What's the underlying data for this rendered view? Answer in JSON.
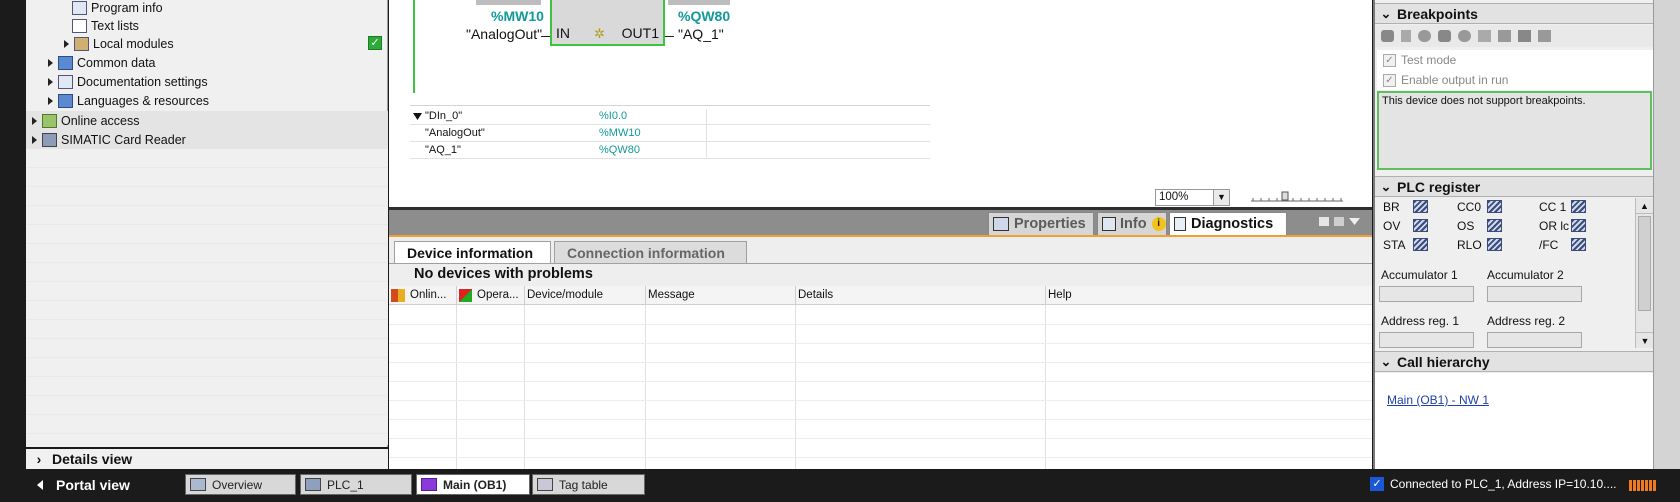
{
  "project_tree": {
    "items": [
      {
        "label": "Program info",
        "indent": 3,
        "icon": "program-info-icon"
      },
      {
        "label": "Text lists",
        "indent": 3,
        "icon": "text-lists-icon"
      },
      {
        "label": "Local modules",
        "indent": 2,
        "icon": "local-modules-icon"
      },
      {
        "label": "Common data",
        "indent": 1,
        "icon": "common-data-icon"
      },
      {
        "label": "Documentation settings",
        "indent": 1,
        "icon": "documentation-settings-icon"
      },
      {
        "label": "Languages & resources",
        "indent": 1,
        "icon": "languages-resources-icon"
      },
      {
        "label": "Online access",
        "indent": 0,
        "icon": "online-access-icon"
      },
      {
        "label": "SIMATIC Card Reader",
        "indent": 0,
        "icon": "card-reader-icon"
      }
    ],
    "details_view_label": "Details view"
  },
  "editor": {
    "in_operand_top": "%MW10",
    "out_operand_top": "%QW80",
    "in_tag": "\"AnalogOut\"",
    "out_tag": "\"AQ_1\"",
    "pin_in": "IN",
    "pin_out": "OUT1",
    "tag_table": [
      {
        "name": "\"DIn_0\"",
        "address": "%I0.0"
      },
      {
        "name": "\"AnalogOut\"",
        "address": "%MW10"
      },
      {
        "name": "\"AQ_1\"",
        "address": "%QW80"
      }
    ],
    "zoom": "100%"
  },
  "inspector": {
    "tabs": [
      "Properties",
      "Info",
      "Diagnostics"
    ],
    "subtabs": [
      "Device information",
      "Connection information"
    ],
    "status": "No devices with problems",
    "columns": [
      "Onlin...",
      "Opera...",
      "Device/module",
      "Message",
      "Details",
      "Help"
    ]
  },
  "task_pane": {
    "breakpoints": {
      "title": "Breakpoints",
      "test_mode": "Test mode",
      "enable_output": "Enable output in run",
      "message": "This device does not support breakpoints."
    },
    "plc_register": {
      "title": "PLC register",
      "bits": [
        "BR",
        "CC0",
        "CC 1",
        "OV",
        "OS",
        "OR lc",
        "STA",
        "RLO",
        "/FC"
      ],
      "accumulator1": "Accumulator 1",
      "accumulator2": "Accumulator 2",
      "address1": "Address reg. 1",
      "address2": "Address reg. 2"
    },
    "call_hierarchy": {
      "title": "Call hierarchy",
      "link": "Main (OB1) - NW 1"
    }
  },
  "bottom_bar": {
    "portal_view": "Portal view",
    "tasks": [
      "Overview",
      "PLC_1",
      "Main (OB1)",
      "Tag table"
    ],
    "status": "Connected to PLC_1, Address IP=10.10...."
  },
  "colors": {
    "accent_teal": "#12999a",
    "focus_green": "#3cc43c",
    "ok_green": "#2eaa3a",
    "link_blue": "#1f3fae",
    "orange": "#f0a030"
  }
}
